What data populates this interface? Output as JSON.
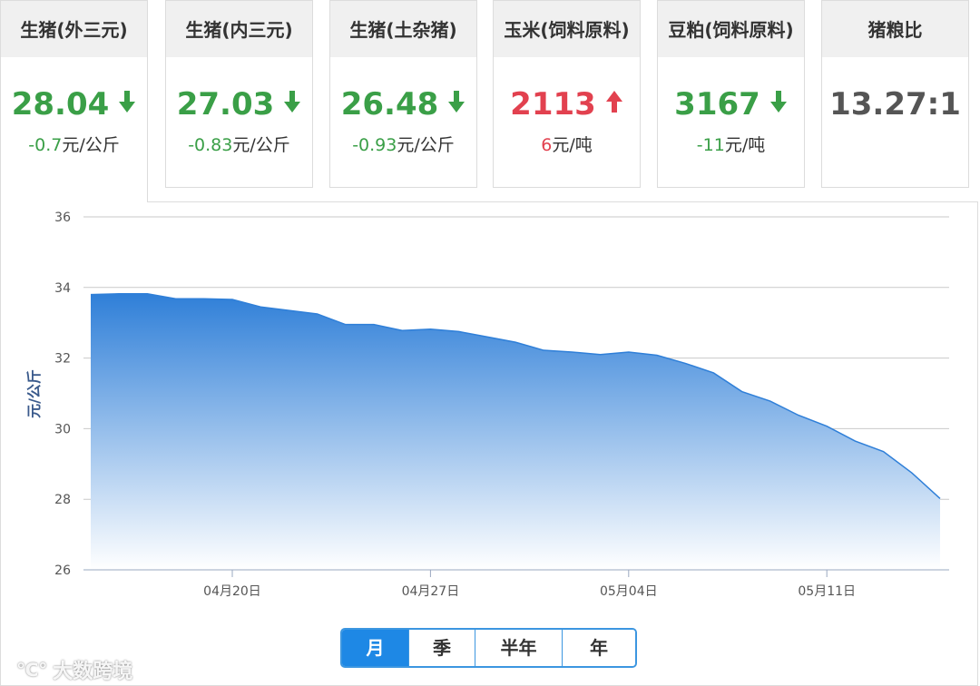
{
  "cards": [
    {
      "title": "生猪(外三元)",
      "value": "28.04",
      "direction": "down",
      "change_num": "-0.7",
      "change_unit": "元/公斤",
      "color": "#3a9f47"
    },
    {
      "title": "生猪(内三元)",
      "value": "27.03",
      "direction": "down",
      "change_num": "-0.83",
      "change_unit": "元/公斤",
      "color": "#3a9f47"
    },
    {
      "title": "生猪(土杂猪)",
      "value": "26.48",
      "direction": "down",
      "change_num": "-0.93",
      "change_unit": "元/公斤",
      "color": "#3a9f47"
    },
    {
      "title": "玉米(饲料原料)",
      "value": "2113",
      "direction": "up",
      "change_num": "6",
      "change_unit": "元/吨",
      "color": "#e2414f"
    },
    {
      "title": "豆粕(饲料原料)",
      "value": "3167",
      "direction": "down",
      "change_num": "-11",
      "change_unit": "元/吨",
      "color": "#3a9f47"
    },
    {
      "title": "猪粮比",
      "value": "13.27:1",
      "direction": "none",
      "change_num": "",
      "change_unit": "",
      "color": "#555555"
    }
  ],
  "period_buttons": [
    {
      "label": "月",
      "active": true
    },
    {
      "label": "季",
      "active": false
    },
    {
      "label": "半年",
      "active": false
    },
    {
      "label": "年",
      "active": false
    }
  ],
  "watermark": "大数跨境",
  "colors": {
    "up": "#e2414f",
    "down": "#3a9f47",
    "area_top": "#2f7fd8",
    "area_bottom": "#ffffff",
    "button_accent": "#1e88e5"
  },
  "chart_data": {
    "type": "area",
    "ylabel": "元/公斤",
    "xlabel": "",
    "ylim": [
      26,
      36
    ],
    "yticks": [
      26,
      28,
      30,
      32,
      34,
      36
    ],
    "xticks": [
      {
        "label": "04月20日",
        "x": 5
      },
      {
        "label": "04月27日",
        "x": 12
      },
      {
        "label": "05月04日",
        "x": 19
      },
      {
        "label": "05月11日",
        "x": 26
      }
    ],
    "x": [
      0,
      1,
      2,
      3,
      4,
      5,
      6,
      7,
      8,
      9,
      10,
      11,
      12,
      13,
      14,
      15,
      16,
      17,
      18,
      19,
      20,
      21,
      22,
      23,
      24,
      25,
      26,
      27,
      28,
      29,
      30
    ],
    "values": [
      33.8,
      33.82,
      33.82,
      33.68,
      33.68,
      33.66,
      33.45,
      33.35,
      33.25,
      32.95,
      32.95,
      32.78,
      32.82,
      32.75,
      32.6,
      32.45,
      32.22,
      32.17,
      32.1,
      32.17,
      32.08,
      31.85,
      31.58,
      31.05,
      30.78,
      30.38,
      30.07,
      29.65,
      29.35,
      28.75,
      28.02
    ],
    "grid": true,
    "legend": "none"
  }
}
